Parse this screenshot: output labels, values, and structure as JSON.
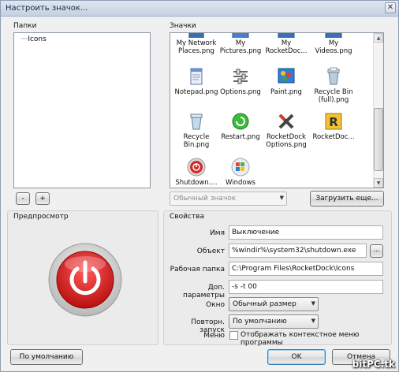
{
  "window": {
    "title": "Настроить значок...",
    "close_symbol": "✕"
  },
  "folders": {
    "label": "Папки",
    "tree_items": [
      "Icons"
    ],
    "remove_label": "-",
    "add_label": "+"
  },
  "icons": {
    "label": "Значки",
    "items": [
      {
        "label": "My Network Places.png",
        "icon": "network-places-icon"
      },
      {
        "label": "My Pictures.png",
        "icon": "pictures-folder-icon"
      },
      {
        "label": "My RocketDoc...",
        "icon": "rocketdock-folder-icon"
      },
      {
        "label": "My Videos.png",
        "icon": "videos-folder-icon"
      },
      {
        "label": "Notepad.png",
        "icon": "notepad-icon"
      },
      {
        "label": "Options.png",
        "icon": "options-icon"
      },
      {
        "label": "Paint.png",
        "icon": "paint-icon"
      },
      {
        "label": "Recycle Bin (full).png",
        "icon": "recycle-bin-full-icon"
      },
      {
        "label": "Recycle Bin.png",
        "icon": "recycle-bin-icon"
      },
      {
        "label": "Restart.png",
        "icon": "restart-icon"
      },
      {
        "label": "RocketDock Options.png",
        "icon": "rocketdock-options-icon"
      },
      {
        "label": "RocketDoc...",
        "icon": "rocketdock-logo-icon"
      },
      {
        "label": "Shutdown....",
        "icon": "shutdown-icon"
      },
      {
        "label": "Windows",
        "icon": "windows-logo-icon"
      }
    ],
    "icon_type_select": "Обычный значок",
    "load_more_label": "Загрузить еще..."
  },
  "preview": {
    "label": "Предпросмотр",
    "icon": "shutdown-icon",
    "colors": {
      "ring": "#d0d0d0",
      "red": "#e02020"
    }
  },
  "properties": {
    "label": "Свойства",
    "name_label": "Имя",
    "name_value": "Выключение",
    "target_label": "Объект",
    "target_value": "%windir%\\system32\\shutdown.exe",
    "browse_label": "...",
    "workdir_label": "Рабочая папка",
    "workdir_value": "C:\\Program Files\\RocketDock\\Icons",
    "params_label": "Доп. параметры",
    "params_value": "-s -t 00",
    "window_label": "Окно",
    "window_value": "Обычный размер",
    "relaunch_label": "Повторн. запуск",
    "relaunch_value": "По умолчанию",
    "menu_label": "Меню",
    "menu_checkbox_label": "Отображать контекстное меню программы"
  },
  "footer": {
    "default_label": "По умолчанию",
    "ok_label": "OK",
    "cancel_label": "Отмена"
  },
  "watermark": "bitPC.tk"
}
